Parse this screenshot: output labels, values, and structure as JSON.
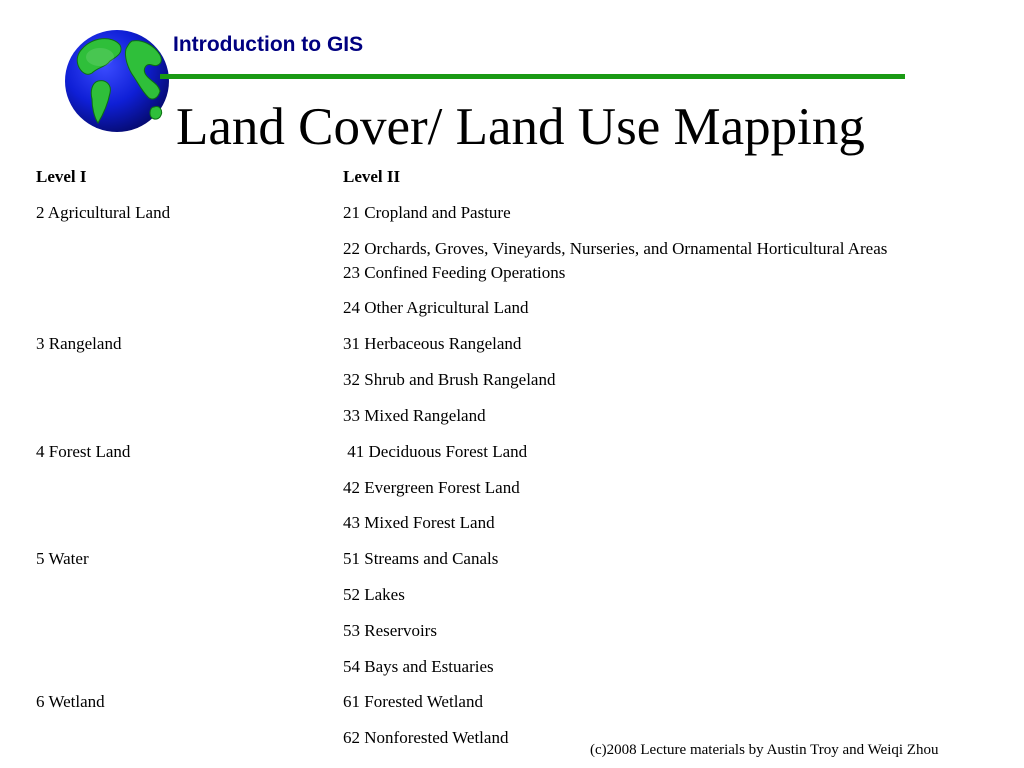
{
  "header": {
    "course_title": "Introduction to GIS",
    "accent_color": "#1a9a14",
    "course_title_color": "#000080",
    "logo_icon": "globe-icon"
  },
  "slide": {
    "title": "Land Cover/ Land Use Mapping"
  },
  "table": {
    "columns": [
      "Level I",
      "Level II"
    ],
    "rows": [
      {
        "level1": "2 Agricultural Land",
        "level2": "21 Cropland and Pasture"
      },
      {
        "level1": "",
        "level2": "22 Orchards, Groves, Vineyards, Nurseries, and Ornamental Horticultural Areas"
      },
      {
        "level1": "",
        "level2": "23 Confined Feeding Operations"
      },
      {
        "level1": "",
        "level2": "24 Other Agricultural Land"
      },
      {
        "level1": "3 Rangeland",
        "level2": "31 Herbaceous Rangeland"
      },
      {
        "level1": "",
        "level2": "32 Shrub and Brush Rangeland"
      },
      {
        "level1": "",
        "level2": "33 Mixed Rangeland"
      },
      {
        "level1": "4 Forest Land",
        "level2": " 41 Deciduous Forest Land"
      },
      {
        "level1": "",
        "level2": "42 Evergreen Forest Land"
      },
      {
        "level1": "",
        "level2": "43 Mixed Forest Land"
      },
      {
        "level1": "5 Water",
        "level2": "51 Streams and Canals"
      },
      {
        "level1": "",
        "level2": "52 Lakes"
      },
      {
        "level1": "",
        "level2": "53 Reservoirs"
      },
      {
        "level1": "",
        "level2": "54 Bays and Estuaries"
      },
      {
        "level1": "6 Wetland",
        "level2": "61 Forested Wetland"
      },
      {
        "level1": "",
        "level2": "62 Nonforested Wetland"
      }
    ]
  },
  "footer": {
    "credit": "(c)2008 Lecture materials by Austin Troy and Weiqi Zhou"
  }
}
